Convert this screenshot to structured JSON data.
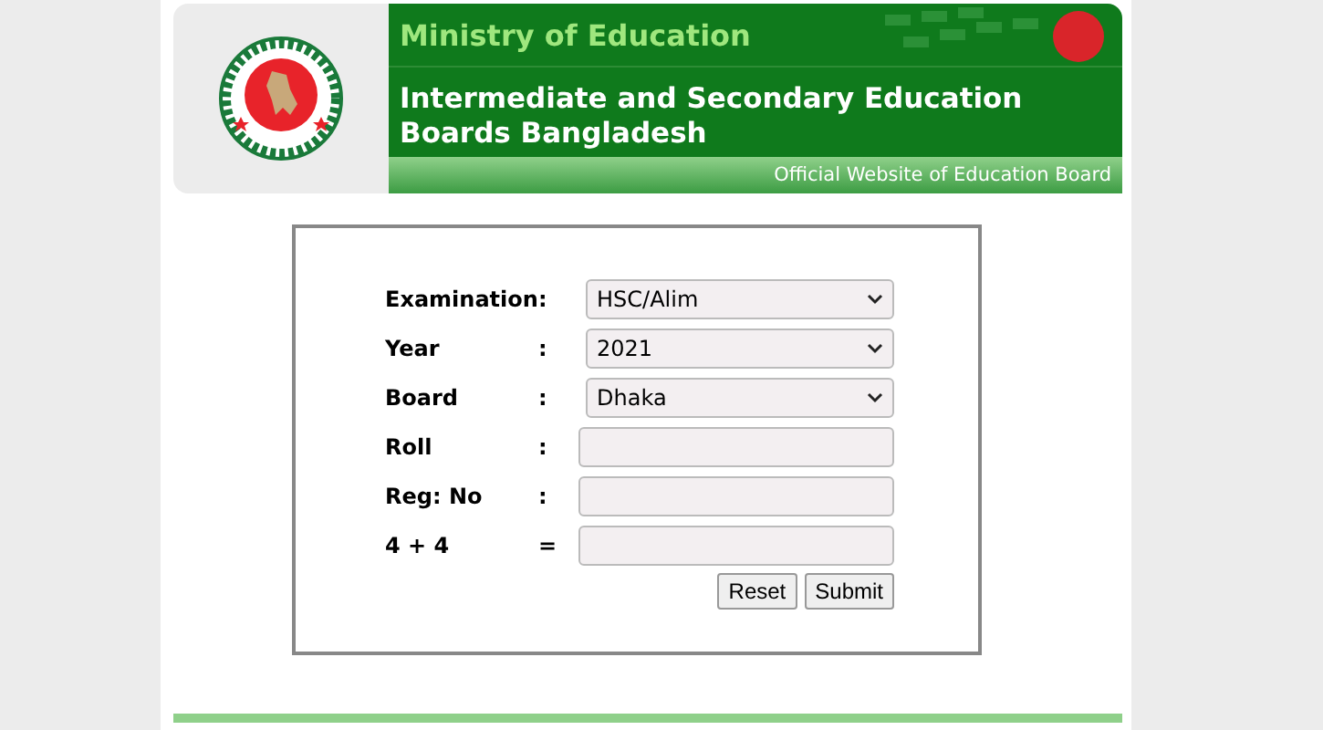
{
  "header": {
    "ministry": "Ministry of Education",
    "title": "Intermediate and Secondary Education Boards Bangladesh",
    "tagline": "Official Website of Education Board"
  },
  "form": {
    "fields": [
      {
        "label": "Examination",
        "separator": ":",
        "kind": "select",
        "value": "HSC/Alim"
      },
      {
        "label": "Year",
        "separator": ":",
        "kind": "select",
        "value": "2021"
      },
      {
        "label": "Board",
        "separator": ":",
        "kind": "select",
        "value": "Dhaka"
      },
      {
        "label": "Roll",
        "separator": ":",
        "kind": "text"
      },
      {
        "label": "Reg: No",
        "separator": ":",
        "kind": "text"
      },
      {
        "label": "4 + 4",
        "separator": "=",
        "kind": "text"
      }
    ],
    "buttons": [
      "Reset",
      "Submit"
    ]
  }
}
